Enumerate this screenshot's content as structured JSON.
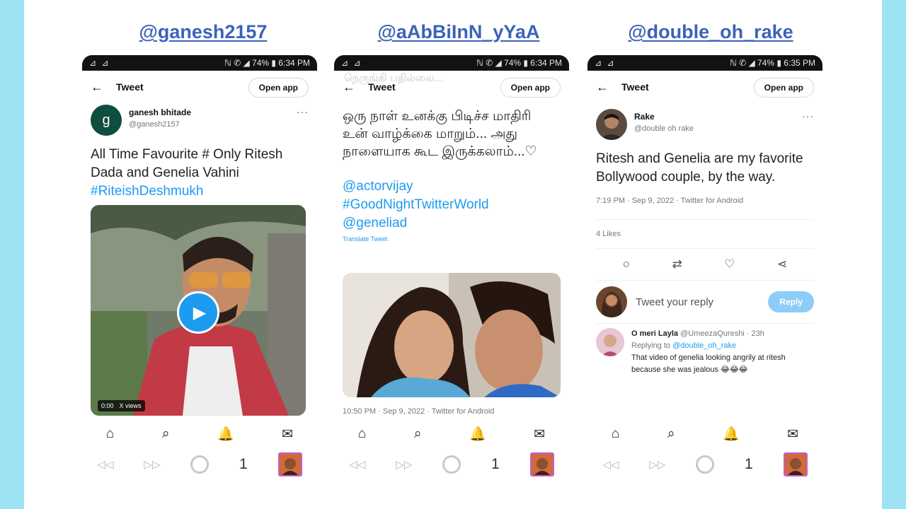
{
  "handles": [
    "@ganesh2157",
    "@aAbBiInN_yYaA",
    "@double_oh_rake"
  ],
  "phones": [
    {
      "status_left": "⊿ ⊿",
      "status_right": "ℕ ✆ ◢ 74% ▮ 6:34 PM",
      "header_title": "Tweet",
      "open_app": "Open app",
      "user_name": "ganesh bhitade",
      "user_handle": "@ganesh2157",
      "tweet_text": "All Time Favourite # Only Ritesh Dada and Genelia Vahini",
      "hashtag": "#RiteishDeshmukh",
      "video_duration": "0:00",
      "video_views": "X views",
      "avatar_letter": "g"
    },
    {
      "status_left": "⊿ ⊿",
      "status_right": "ℕ ✆ ◢ 74% ▮ 6:34 PM",
      "header_title": "Tweet",
      "open_app": "Open app",
      "faded_text": "நெருங்கி பதில்லை...",
      "tweet_text": "ஒரு நாள் உனக்கு பிடிச்ச மாதிரி உன் வாழ்க்கை மாறும்... அது நாளையாக கூட இருக்கலாம்...♡",
      "mention1": "@actorvijay",
      "hashtag": "#GoodNightTwitterWorld",
      "mention2": "@geneliad",
      "translate": "Translate Tweet",
      "timestamp": "10:50 PM · Sep 9, 2022 · Twitter for Android"
    },
    {
      "status_left": "⊿ ⊿",
      "status_right": "ℕ ✆ ◢ 74% ▮ 6:35 PM",
      "header_title": "Tweet",
      "open_app": "Open app",
      "user_name": "Rake",
      "user_handle": "@double oh rake",
      "tweet_text": "Ritesh and Genelia are my favorite Bollywood couple, by the way.",
      "timestamp": "7:19 PM · Sep 9, 2022 · Twitter for Android",
      "likes": "4 Likes",
      "reply_placeholder": "Tweet your reply",
      "reply_button": "Reply",
      "comment_name": "O meri Layla",
      "comment_handle": "@UmeezaQureshi · 23h",
      "replying_prefix": "Replying to ",
      "replying_to": "@double_oh_rake",
      "comment_text": "That video of genelia looking angrily at ritesh because she was jealous 😂😂😂"
    }
  ],
  "bottom_nav": [
    "⌂",
    "⌕",
    "🔔",
    "✉"
  ],
  "browser": {
    "back": "◁◁",
    "forward": "▷▷",
    "tab_count": "1"
  },
  "colors": {
    "accent": "#1d9bf0",
    "handle": "#3d63b8",
    "bg": "#9ee3f3"
  }
}
